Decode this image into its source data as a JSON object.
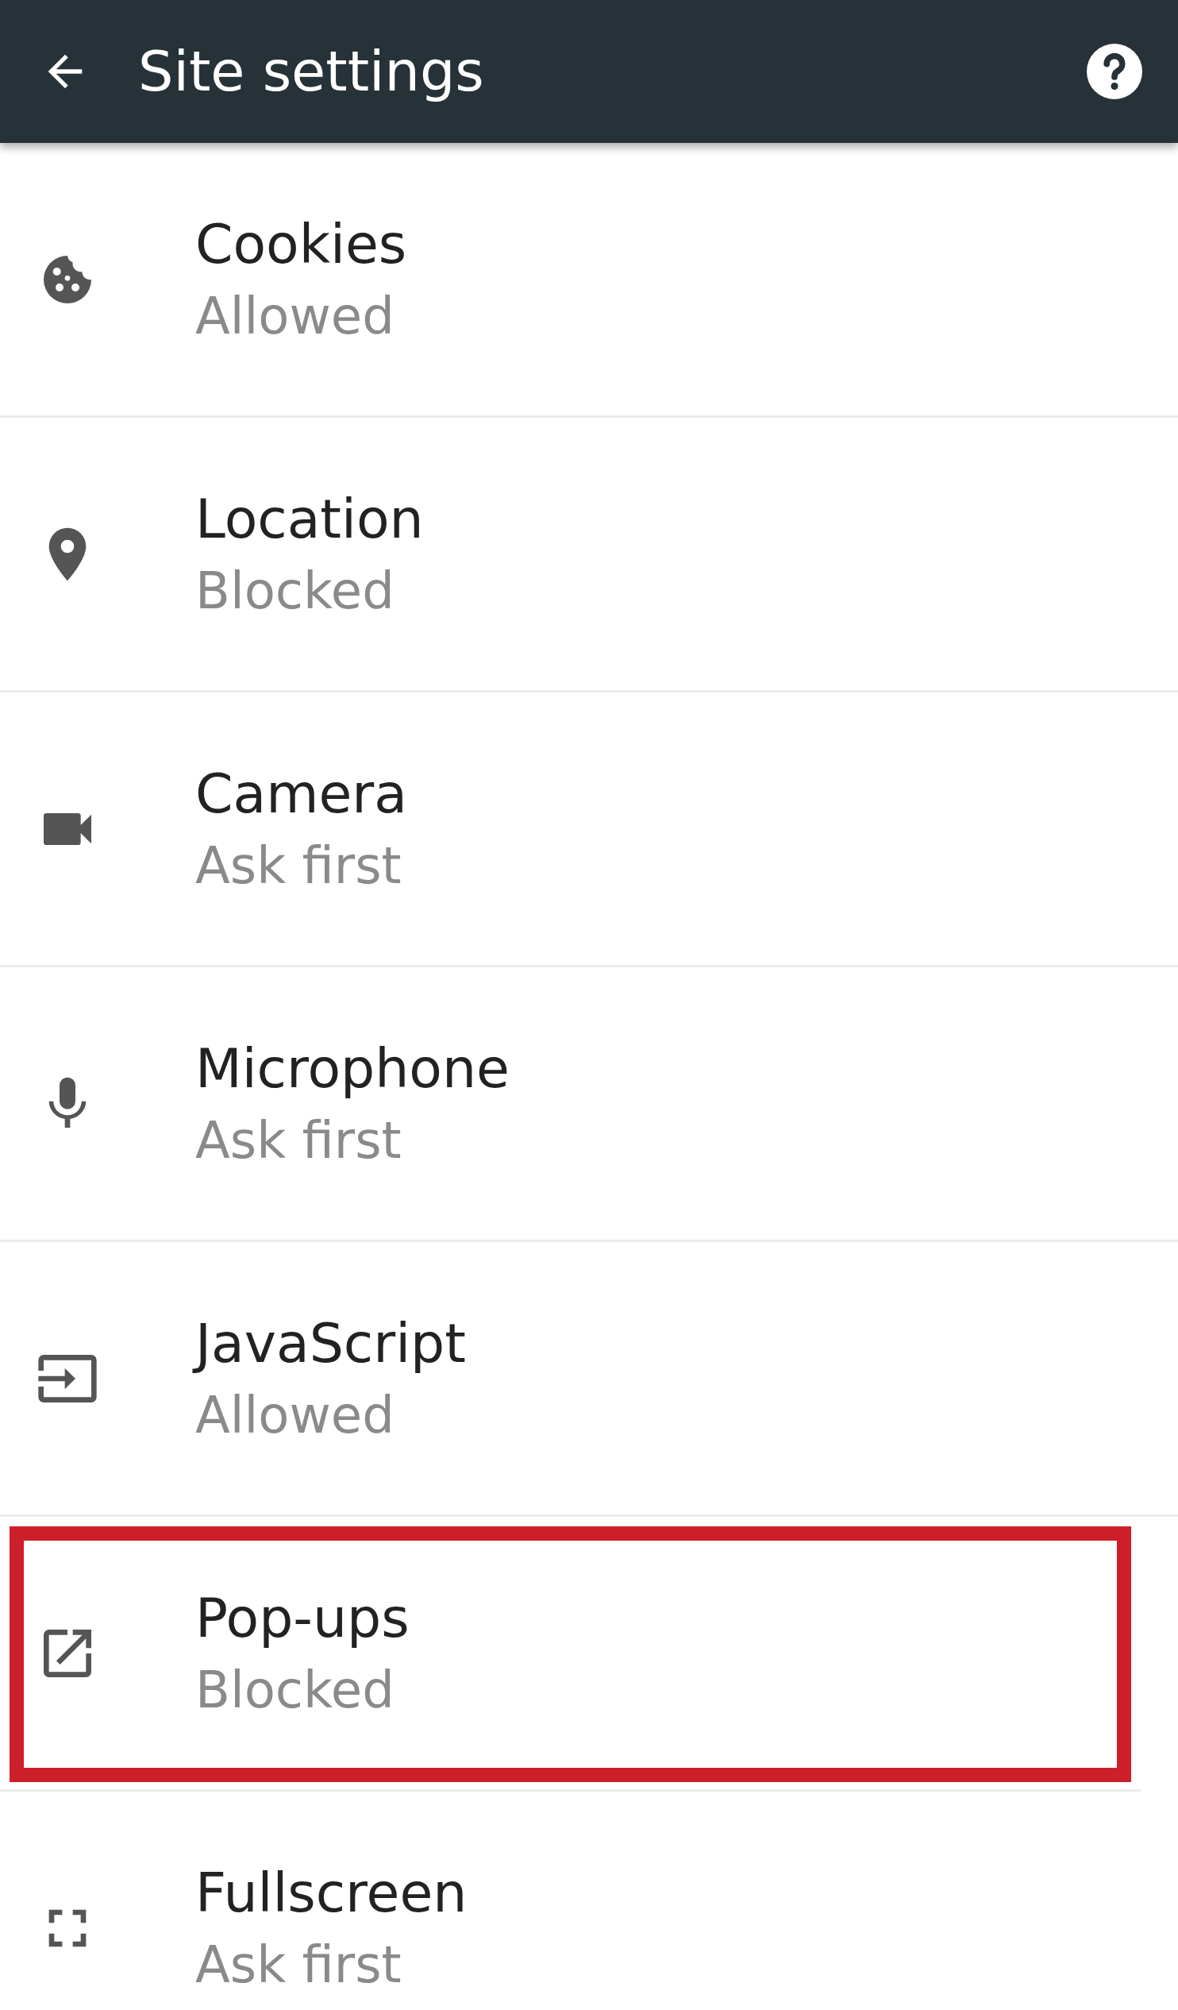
{
  "toolbar": {
    "title": "Site settings"
  },
  "settings": [
    {
      "kind": "cookies",
      "title": "Cookies",
      "status": "Allowed",
      "highlighted": false
    },
    {
      "kind": "location",
      "title": "Location",
      "status": "Blocked",
      "highlighted": false
    },
    {
      "kind": "camera",
      "title": "Camera",
      "status": "Ask first",
      "highlighted": false
    },
    {
      "kind": "microphone",
      "title": "Microphone",
      "status": "Ask first",
      "highlighted": false
    },
    {
      "kind": "javascript",
      "title": "JavaScript",
      "status": "Allowed",
      "highlighted": false
    },
    {
      "kind": "popups",
      "title": "Pop-ups",
      "status": "Blocked",
      "highlighted": true
    },
    {
      "kind": "fullscreen",
      "title": "Fullscreen",
      "status": "Ask first",
      "highlighted": false
    }
  ]
}
